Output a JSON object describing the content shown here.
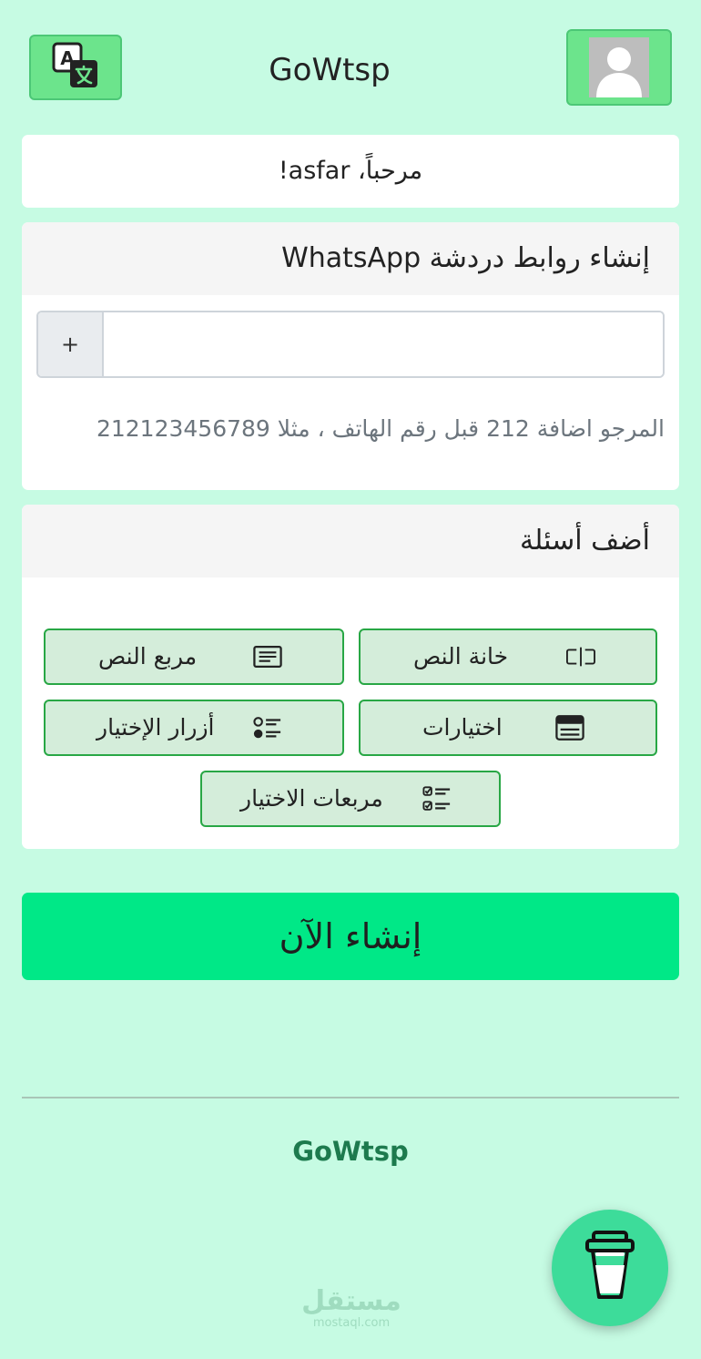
{
  "header": {
    "title": "GoWtsp",
    "translate_icon": "translate-icon",
    "avatar_icon": "user-avatar-icon"
  },
  "greeting": {
    "text": "مرحباً، asfar!"
  },
  "links_section": {
    "title": "إنشاء روابط دردشة WhatsApp",
    "add_button": "+",
    "phone_value": "",
    "phone_placeholder": "",
    "help_text": "المرجو اضافة 212 قبل رقم الهاتف ، مثلا 212123456789"
  },
  "questions_section": {
    "title": "أضف أسئلة",
    "buttons": [
      {
        "label": "خانة النص",
        "icon": "text-input-icon"
      },
      {
        "label": "مربع النص",
        "icon": "textarea-icon"
      },
      {
        "label": "اختيارات",
        "icon": "select-icon"
      },
      {
        "label": "أزرار الإختيار",
        "icon": "radio-list-icon"
      },
      {
        "label": "مربعات الاختيار",
        "icon": "checkbox-list-icon"
      }
    ]
  },
  "create_button": {
    "label": "إنشاء الآن"
  },
  "footer": {
    "brand": "GoWtsp"
  },
  "watermark": {
    "arabic": "مستقل",
    "latin": "mostaql.com"
  },
  "fab": {
    "icon": "coffee-cup-icon"
  },
  "colors": {
    "page_background": "#c6fbe3",
    "header_button": "#6ce48c",
    "question_button_bg": "#d4edda",
    "question_button_border": "#28a745",
    "create_button": "#00e887",
    "footer_brand": "#1d7a4e",
    "fab": "#3ddc9a"
  }
}
